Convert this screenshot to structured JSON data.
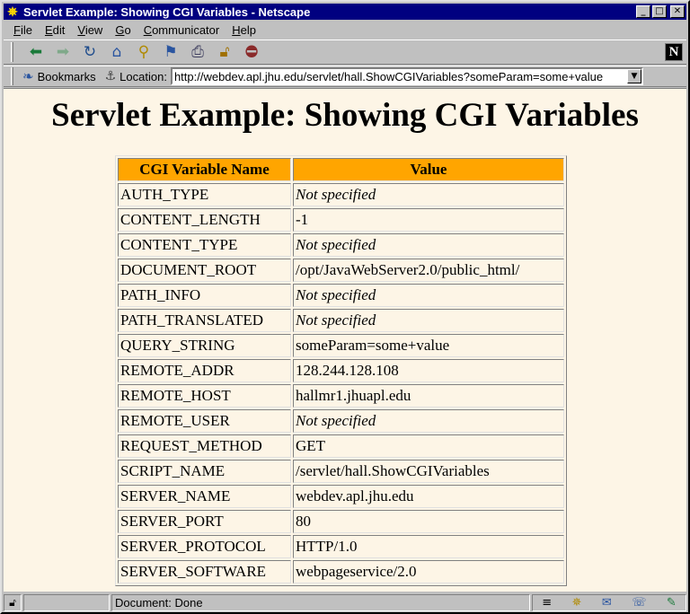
{
  "window": {
    "title": "Servlet Example: Showing CGI Variables - Netscape",
    "app_icon": "netscape-icon",
    "minimize_glyph": "_",
    "maximize_glyph": "□",
    "close_glyph": "✕"
  },
  "menubar": {
    "items": [
      {
        "label": "File"
      },
      {
        "label": "Edit"
      },
      {
        "label": "View"
      },
      {
        "label": "Go"
      },
      {
        "label": "Communicator"
      },
      {
        "label": "Help"
      }
    ]
  },
  "toolbar": {
    "icons": [
      "back-icon",
      "forward-icon",
      "reload-icon",
      "home-icon",
      "search-icon",
      "guide-icon",
      "print-icon",
      "security-icon",
      "stop-icon"
    ],
    "logo": "N"
  },
  "location": {
    "bookmarks_label": "Bookmarks",
    "location_label": "Location:",
    "url": "http://webdev.apl.jhu.edu/servlet/hall.ShowCGIVariables?someParam=some+value"
  },
  "page": {
    "title": "Servlet Example: Showing CGI Variables",
    "background": "#fdf5e6",
    "header_color": "#ffa500",
    "columns": [
      "CGI Variable Name",
      "Value"
    ],
    "rows": [
      {
        "name": "AUTH_TYPE",
        "value": "Not specified",
        "specified": false
      },
      {
        "name": "CONTENT_LENGTH",
        "value": "-1",
        "specified": true
      },
      {
        "name": "CONTENT_TYPE",
        "value": "Not specified",
        "specified": false
      },
      {
        "name": "DOCUMENT_ROOT",
        "value": "/opt/JavaWebServer2.0/public_html/",
        "specified": true
      },
      {
        "name": "PATH_INFO",
        "value": "Not specified",
        "specified": false
      },
      {
        "name": "PATH_TRANSLATED",
        "value": "Not specified",
        "specified": false
      },
      {
        "name": "QUERY_STRING",
        "value": "someParam=some+value",
        "specified": true
      },
      {
        "name": "REMOTE_ADDR",
        "value": "128.244.128.108",
        "specified": true
      },
      {
        "name": "REMOTE_HOST",
        "value": "hallmr1.jhuapl.edu",
        "specified": true
      },
      {
        "name": "REMOTE_USER",
        "value": "Not specified",
        "specified": false
      },
      {
        "name": "REQUEST_METHOD",
        "value": "GET",
        "specified": true
      },
      {
        "name": "SCRIPT_NAME",
        "value": "/servlet/hall.ShowCGIVariables",
        "specified": true
      },
      {
        "name": "SERVER_NAME",
        "value": "webdev.apl.jhu.edu",
        "specified": true
      },
      {
        "name": "SERVER_PORT",
        "value": "80",
        "specified": true
      },
      {
        "name": "SERVER_PROTOCOL",
        "value": "HTTP/1.0",
        "specified": true
      },
      {
        "name": "SERVER_SOFTWARE",
        "value": "webpageservice/2.0",
        "specified": true
      }
    ]
  },
  "statusbar": {
    "text": "Document: Done",
    "icons": [
      "lock-icon",
      "component-bar-icon",
      "navigator-icon",
      "mail-icon",
      "discussion-icon",
      "composer-icon"
    ]
  }
}
